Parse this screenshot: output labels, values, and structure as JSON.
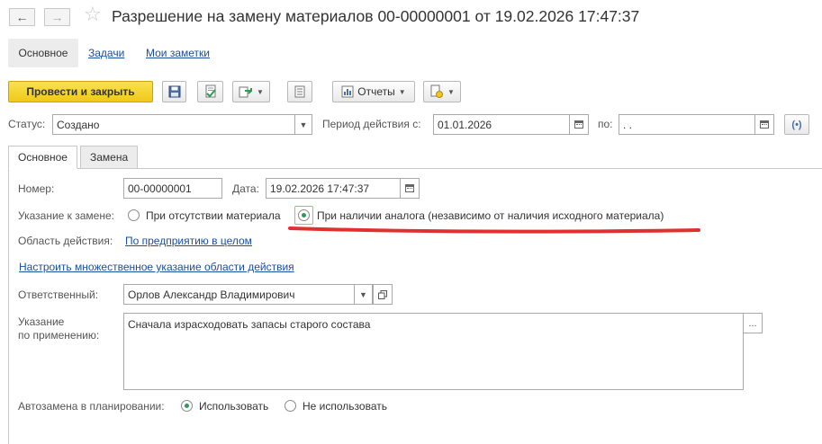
{
  "window": {
    "title": "Разрешение на замену материалов 00-00000001 от 19.02.2026 17:47:37"
  },
  "nav": {
    "back_icon": "arrow-left-icon",
    "forward_icon": "arrow-right-icon",
    "favorite_icon": "star-icon"
  },
  "sections": {
    "main": "Основное",
    "tasks": "Задачи",
    "notes": "Мои заметки"
  },
  "toolbar": {
    "post_close": "Провести и закрыть",
    "reports": "Отчеты"
  },
  "header": {
    "status_label": "Статус:",
    "status_value": "Создано",
    "period_label": "Период действия с:",
    "period_from": "01.01.2026",
    "period_to_label": "по:",
    "period_to": " .  ."
  },
  "tabs": {
    "main": "Основное",
    "replacement": "Замена"
  },
  "form": {
    "number_label": "Номер:",
    "number_value": "00-00000001",
    "date_label": "Дата:",
    "date_value": "19.02.2026 17:47:37",
    "replace_label": "Указание к замене:",
    "option_absent": "При отсутствии материала",
    "option_analog": "При наличии аналога (независимо от наличия исходного материала)",
    "selected_option": "option_analog",
    "scope_label": "Область действия:",
    "scope_value": "По предприятию в целом",
    "multi_scope_link": "Настроить множественное указание области действия",
    "responsible_label": "Ответственный:",
    "responsible_value": "Орлов Александр Владимирович",
    "usage_label_1": "Указание",
    "usage_label_2": "по применению:",
    "usage_value": "Сначала израсходовать запасы старого состава",
    "autoreplace_label": "Автозамена в планировании:",
    "auto_use": "Использовать",
    "auto_not_use": "Не использовать",
    "auto_selected": "auto_use"
  },
  "colors": {
    "primary_button": "#f0c818",
    "link": "#1a4fa0",
    "radio_selected": "#2f9a55",
    "annotation_underline": "#e03030"
  }
}
